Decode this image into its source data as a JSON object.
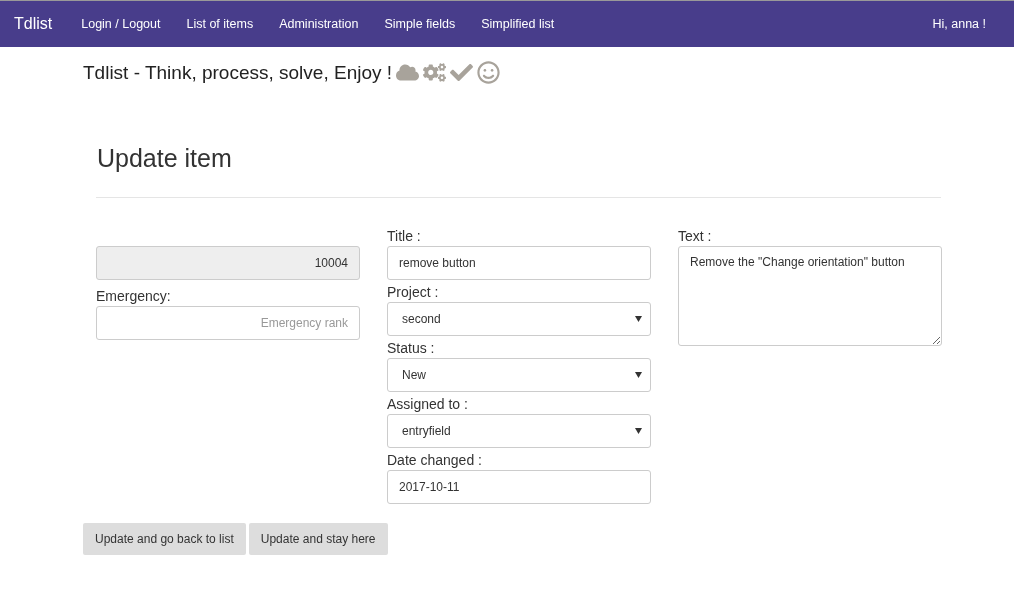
{
  "navbar": {
    "brand": "Tdlist",
    "items": [
      "Login / Logout",
      "List of items",
      "Administration",
      "Simple fields",
      "Simplified list"
    ],
    "greeting": "Hi, anna !"
  },
  "tagline": "Tdlist - Think, process, solve, Enjoy !",
  "page_title": "Update item",
  "left": {
    "id_value": "10004",
    "emergency_label": "Emergency:",
    "emergency_placeholder": "Emergency rank"
  },
  "fields": [
    {
      "kind": "input",
      "label": "Title :",
      "value": "remove button"
    },
    {
      "kind": "select",
      "label": "Project :",
      "value": "second"
    },
    {
      "kind": "select",
      "label": "Status :",
      "value": "New"
    },
    {
      "kind": "select",
      "label": "Assigned to :",
      "value": "entryfield"
    },
    {
      "kind": "input",
      "label": "Date changed :",
      "value": "2017-10-11"
    }
  ],
  "text": {
    "label": "Text :",
    "value": "Remove the \"Change orientation\" button"
  },
  "buttons": [
    "Update and go back to list",
    "Update and stay here"
  ]
}
